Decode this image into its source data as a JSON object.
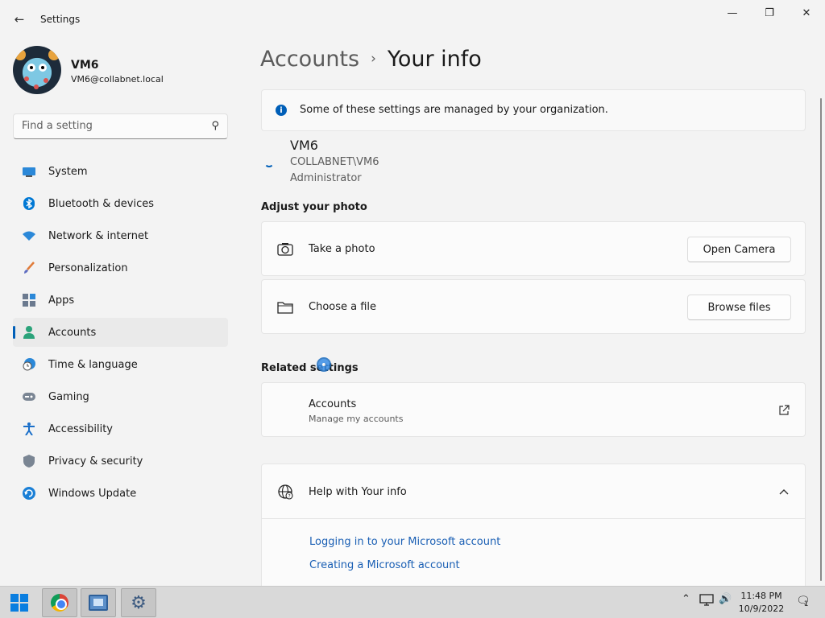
{
  "window": {
    "title": "Settings"
  },
  "profile": {
    "name": "VM6",
    "email": "VM6@collabnet.local"
  },
  "search": {
    "placeholder": "Find a setting",
    "value": ""
  },
  "sidebar": {
    "items": [
      {
        "label": "System",
        "icon": "monitor-icon",
        "active": false
      },
      {
        "label": "Bluetooth & devices",
        "icon": "bluetooth-icon",
        "active": false
      },
      {
        "label": "Network & internet",
        "icon": "wifi-icon",
        "active": false
      },
      {
        "label": "Personalization",
        "icon": "brush-icon",
        "active": false
      },
      {
        "label": "Apps",
        "icon": "apps-icon",
        "active": false
      },
      {
        "label": "Accounts",
        "icon": "person-icon",
        "active": true
      },
      {
        "label": "Time & language",
        "icon": "clock-globe-icon",
        "active": false
      },
      {
        "label": "Gaming",
        "icon": "gamepad-icon",
        "active": false
      },
      {
        "label": "Accessibility",
        "icon": "accessibility-icon",
        "active": false
      },
      {
        "label": "Privacy & security",
        "icon": "shield-icon",
        "active": false
      },
      {
        "label": "Windows Update",
        "icon": "update-icon",
        "active": false
      }
    ]
  },
  "breadcrumb": {
    "parent": "Accounts",
    "separator": "›",
    "current": "Your info"
  },
  "infobar": {
    "text": "Some of these settings are managed by your organization."
  },
  "user": {
    "name": "VM6",
    "domain": "COLLABNET\\VM6",
    "role": "Administrator"
  },
  "photo_section": {
    "title": "Adjust your photo",
    "take_photo": {
      "label": "Take a photo",
      "button": "Open Camera"
    },
    "choose_file": {
      "label": "Choose a file",
      "button": "Browse files"
    }
  },
  "related": {
    "title": "Related settings",
    "accounts": {
      "label": "Accounts",
      "sub": "Manage my accounts"
    }
  },
  "help": {
    "title": "Help with Your info",
    "links": [
      "Logging in to your Microsoft account",
      "Creating a Microsoft account"
    ]
  },
  "taskbar": {
    "time": "11:48 PM",
    "date": "10/9/2022",
    "notification_count": "1"
  },
  "colors": {
    "accent": "#005fb8",
    "link": "#1a5fb4",
    "background": "#f3f3f3"
  }
}
